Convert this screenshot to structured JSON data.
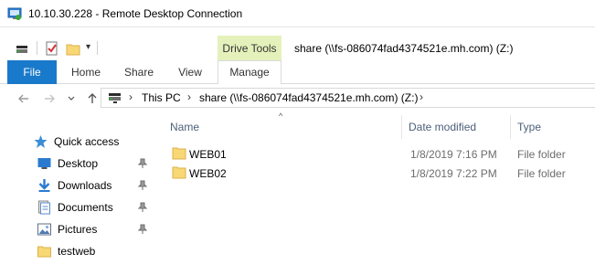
{
  "rdp": {
    "title": "10.10.30.228 - Remote Desktop Connection"
  },
  "explorer": {
    "context_tab_group": "Drive Tools",
    "window_title": "share (\\\\fs-086074fad4374521e.mh.com) (Z:)"
  },
  "ribbon": {
    "tabs": [
      "File",
      "Home",
      "Share",
      "View",
      "Manage"
    ]
  },
  "address": {
    "crumbs": [
      "This PC",
      "share (\\\\fs-086074fad4374521e.mh.com) (Z:)"
    ]
  },
  "columns": {
    "name": "Name",
    "date": "Date modified",
    "type": "Type"
  },
  "nav_pane": {
    "items": [
      {
        "label": "Quick access",
        "icon": "star-icon"
      },
      {
        "label": "Desktop",
        "icon": "desktop-icon",
        "pinned": true
      },
      {
        "label": "Downloads",
        "icon": "download-icon",
        "pinned": true
      },
      {
        "label": "Documents",
        "icon": "documents-icon",
        "pinned": true
      },
      {
        "label": "Pictures",
        "icon": "pictures-icon",
        "pinned": true
      },
      {
        "label": "testweb",
        "icon": "folder-icon",
        "pinned": false
      }
    ]
  },
  "files": [
    {
      "name": "WEB01",
      "date": "1/8/2019 7:16 PM",
      "type": "File folder"
    },
    {
      "name": "WEB02",
      "date": "1/8/2019 7:22 PM",
      "type": "File folder"
    }
  ],
  "colors": {
    "file_tab": "#1979ca",
    "drive_tools": "#e5f1bb",
    "folder": "#f8d775",
    "header_text": "#4c607a"
  }
}
